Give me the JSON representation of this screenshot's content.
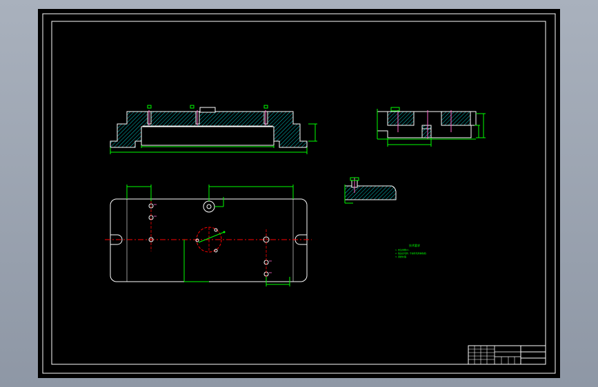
{
  "drawing": {
    "background": "#000000",
    "viewport_background": "#9aa3b0",
    "colors": {
      "outline": "#ffffff",
      "dimension": "#00ff00",
      "hatch": "#00cccc",
      "centerline": "#ff0000",
      "hole": "#ffffff",
      "accent": "#ff66cc"
    },
    "technical_notes": {
      "title": "技术要求",
      "lines": [
        "1. 未注倒角C1.",
        "2. 锐边去毛刺, 不得有毛刺等缺陷.",
        "3. 调质处理."
      ]
    },
    "title_block": {
      "cells": []
    }
  }
}
